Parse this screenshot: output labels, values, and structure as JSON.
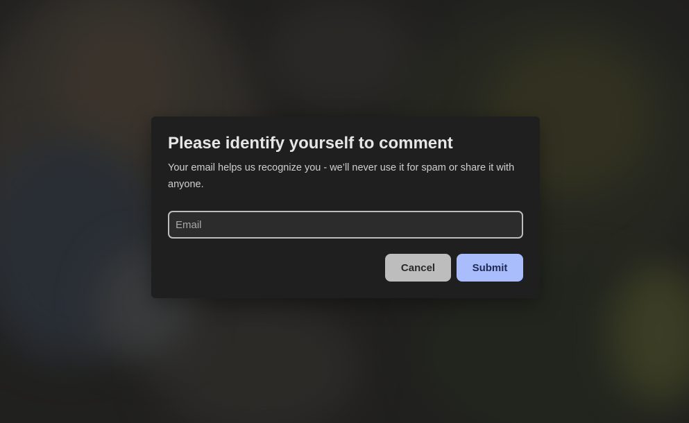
{
  "dialog": {
    "title": "Please identify yourself to comment",
    "description": "Your email helps us recognize you - we’ll never use it for spam or share it with anyone.",
    "email_placeholder": "Email",
    "email_value": "",
    "cancel_label": "Cancel",
    "submit_label": "Submit"
  },
  "colors": {
    "dialog_background": "#1f1f1f",
    "submit_button": "#a9bdfc",
    "cancel_button": "#bdbdbd"
  }
}
